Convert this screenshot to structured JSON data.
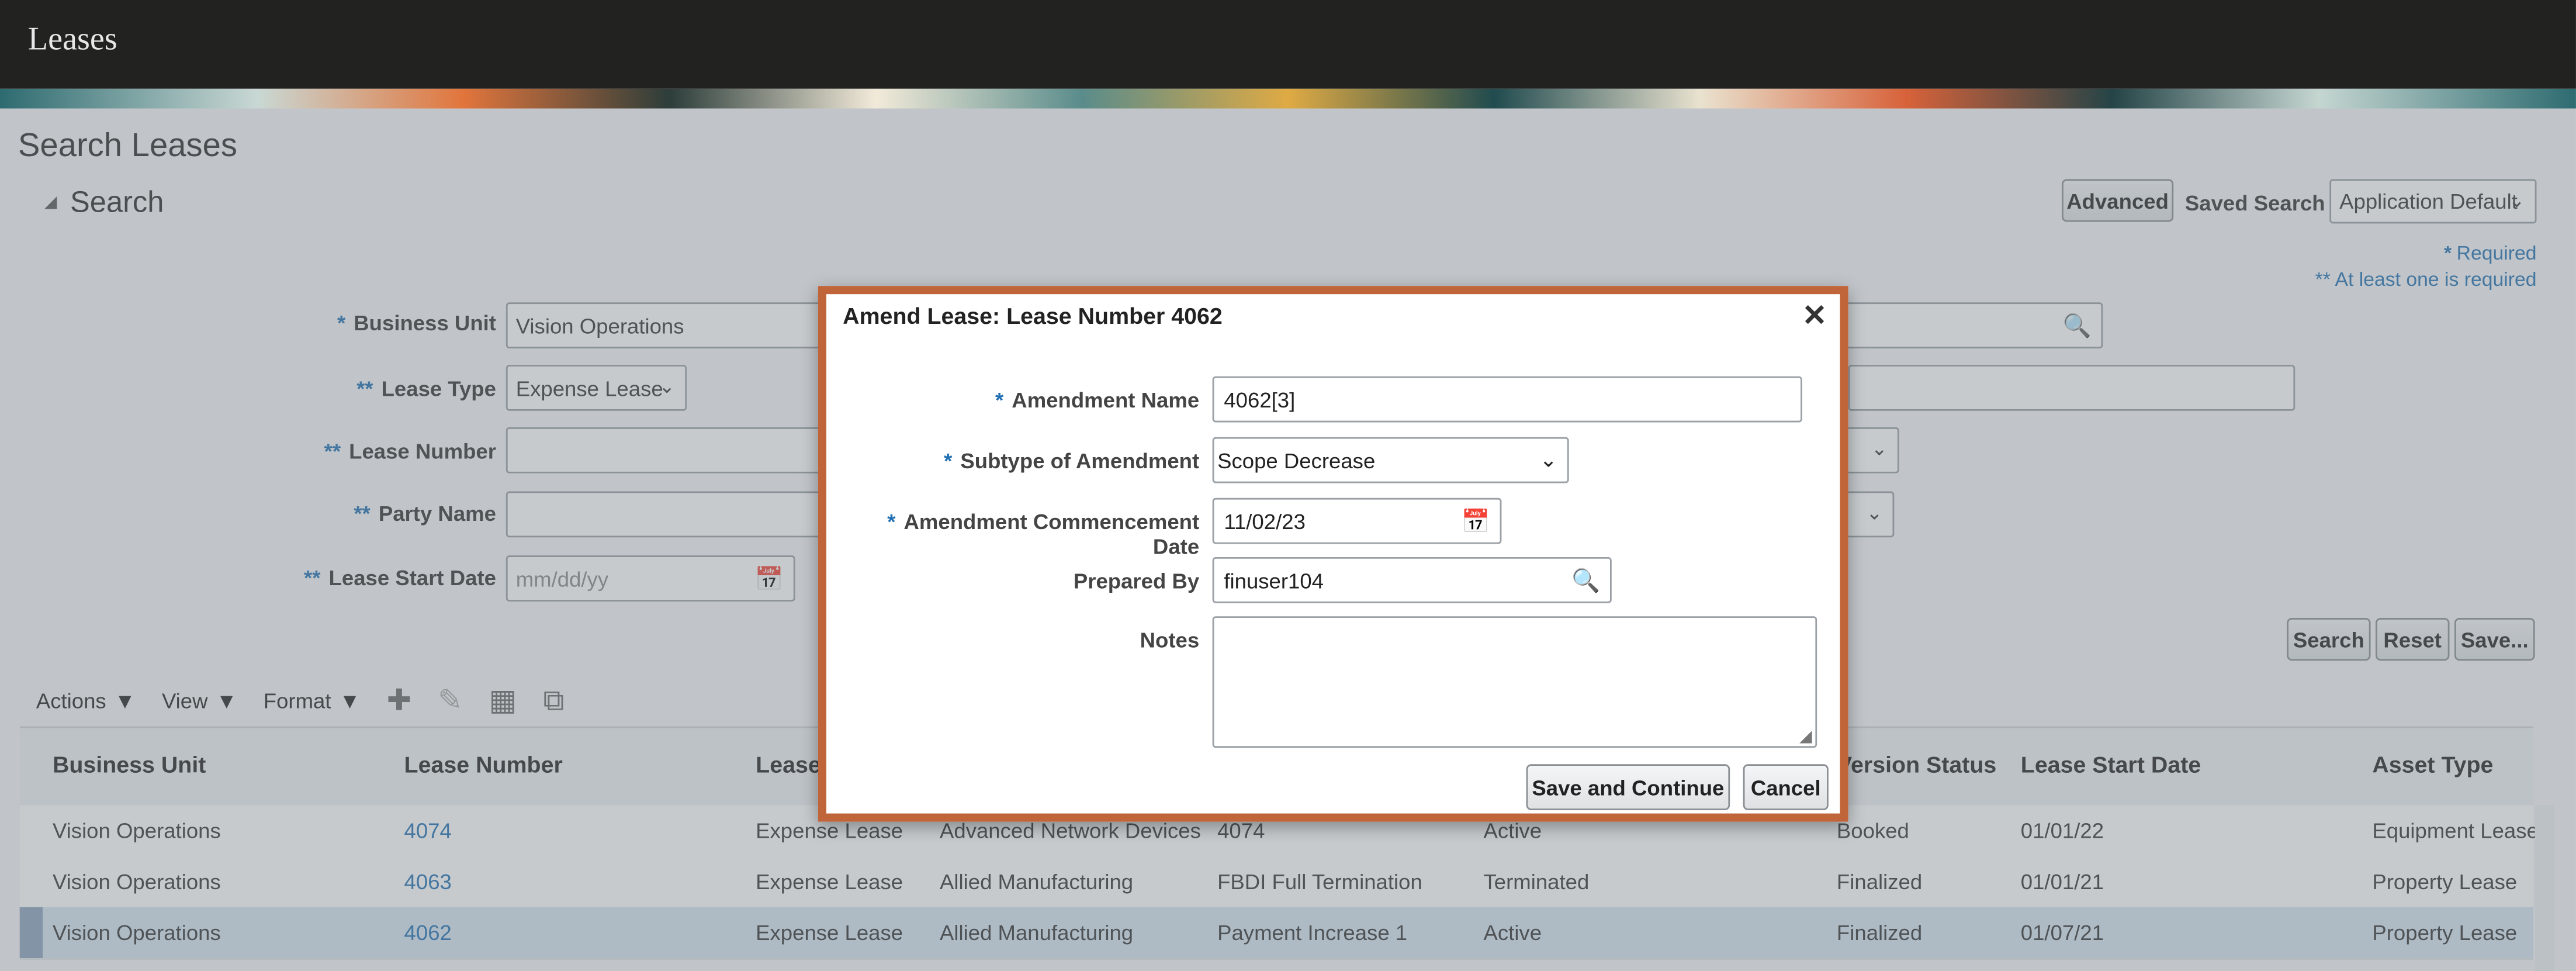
{
  "app": {
    "title": "Leases"
  },
  "page": {
    "title": "Search Leases"
  },
  "search": {
    "section_label": "Search",
    "advanced_label": "Advanced",
    "saved_search_label": "Saved Search",
    "saved_search_value": "Application Default",
    "required_note": "Required",
    "at_least_one_note": "** At least one is required",
    "fields": {
      "business_unit": {
        "label": "Business Unit",
        "value": "Vision Operations",
        "marker": "*"
      },
      "lease_type": {
        "label": "Lease Type",
        "value": "Expense Lease",
        "marker": "**"
      },
      "lease_number": {
        "label": "Lease Number",
        "value": "",
        "marker": "**"
      },
      "party_name": {
        "label": "Party Name",
        "value": "",
        "marker": "**"
      },
      "lease_start_date": {
        "label": "Lease Start Date",
        "placeholder": "mm/dd/yy",
        "marker": "**"
      }
    },
    "buttons": {
      "search": "Search",
      "reset": "Reset",
      "save": "Save..."
    }
  },
  "toolbar": {
    "actions": "Actions",
    "view": "View",
    "format": "Format"
  },
  "table": {
    "headers": [
      "Business Unit",
      "Lease Number",
      "Lease",
      "Version Status",
      "Lease Start Date",
      "Asset Type"
    ],
    "rows": [
      {
        "business_unit": "Vision Operations",
        "lease_number": "4074",
        "lease_type": "Expense Lease",
        "party": "Advanced Network Devices",
        "amendment": "4074",
        "status": "Active",
        "version_status": "Booked",
        "start_date": "01/01/22",
        "asset_type": "Equipment Lease"
      },
      {
        "business_unit": "Vision Operations",
        "lease_number": "4063",
        "lease_type": "Expense Lease",
        "party": "Allied Manufacturing",
        "amendment": "FBDI Full Termination",
        "status": "Terminated",
        "version_status": "Finalized",
        "start_date": "01/01/21",
        "asset_type": "Property Lease"
      },
      {
        "business_unit": "Vision Operations",
        "lease_number": "4062",
        "lease_type": "Expense Lease",
        "party": "Allied Manufacturing",
        "amendment": "Payment Increase 1",
        "status": "Active",
        "version_status": "Finalized",
        "start_date": "01/07/21",
        "asset_type": "Property Lease"
      }
    ]
  },
  "dialog": {
    "title": "Amend Lease: Lease Number 4062",
    "amendment_name": {
      "label": "Amendment Name",
      "value": "4062[3]"
    },
    "subtype": {
      "label": "Subtype of Amendment",
      "value": "Scope Decrease"
    },
    "commencement_date": {
      "label": "Amendment Commencement Date",
      "value": "11/02/23"
    },
    "prepared_by": {
      "label": "Prepared By",
      "value": "finuser104"
    },
    "notes": {
      "label": "Notes",
      "value": ""
    },
    "save_continue": "Save and Continue",
    "cancel": "Cancel"
  },
  "colors": {
    "header_bg": "#222220",
    "dialog_border": "#c0653a",
    "link": "#1f6fb2",
    "selected_row": "#d6e5f2"
  }
}
